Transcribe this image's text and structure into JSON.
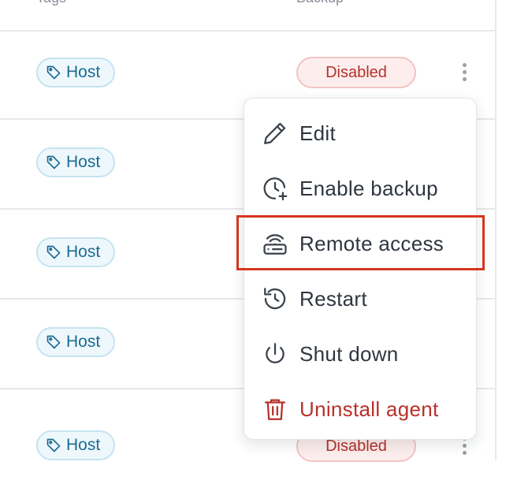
{
  "table": {
    "columns": {
      "tags": "Tags",
      "backup": "Backup"
    },
    "rows": [
      {
        "tag": "Host",
        "backup": "Disabled"
      },
      {
        "tag": "Host"
      },
      {
        "tag": "Host"
      },
      {
        "tag": "Host"
      },
      {
        "tag": "Host",
        "backup": "Disabled"
      }
    ]
  },
  "menu": {
    "items": [
      {
        "label": "Edit",
        "icon": "pencil-icon"
      },
      {
        "label": "Enable backup",
        "icon": "clock-plus-icon"
      },
      {
        "label": "Remote access",
        "icon": "router-icon"
      },
      {
        "label": "Restart",
        "icon": "restart-icon"
      },
      {
        "label": "Shut down",
        "icon": "power-icon"
      },
      {
        "label": "Uninstall agent",
        "icon": "trash-icon",
        "color": "#b8312a"
      }
    ],
    "highlighted": "Remote access"
  },
  "colors": {
    "tag_text": "#1b6b92",
    "tag_border": "#c5e3f0",
    "badge_text": "#b4302a",
    "badge_border": "#f2c4c2",
    "highlight": "#d6361f",
    "danger": "#b8312a"
  }
}
